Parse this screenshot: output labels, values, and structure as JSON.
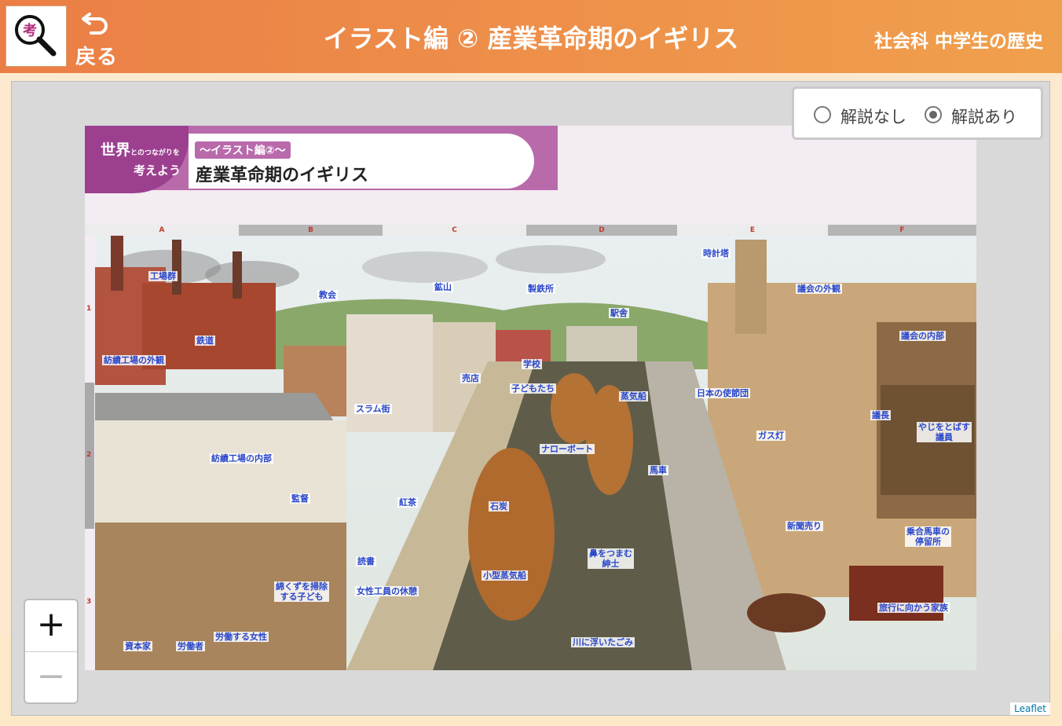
{
  "header": {
    "back_label": "戻る",
    "title": "イラスト編 ② 産業革命期のイギリス",
    "subject": "社会科 中学生の歴史",
    "colors": {
      "from": "#eb7e46",
      "to": "#f0a04d"
    },
    "logo_icon": "magnifier-kou-icon",
    "back_icon": "undo-arrow-icon"
  },
  "controls": {
    "radio_off_label": "解説なし",
    "radio_on_label": "解説あり",
    "selected": "解説あり",
    "zoom_in": "+",
    "zoom_out": "−",
    "attribution": "Leaflet"
  },
  "plate": {
    "badge_line1": "世界",
    "badge_small": "とのつながりを",
    "badge_line2": "考えよう",
    "tag": "〜イラスト編②〜",
    "title": "産業革命期のイギリス",
    "columns": [
      "A",
      "B",
      "C",
      "D",
      "E",
      "F"
    ],
    "rows": [
      "1",
      "2",
      "3"
    ]
  },
  "labels": [
    "工場群",
    "教会",
    "鉱山",
    "製鉄所",
    "時計塔",
    "議会の外観",
    "駅舎",
    "鉄道",
    "紡績工場の外観",
    "学校",
    "子どもたち",
    "売店",
    "スラム街",
    "蒸気船",
    "日本の使節団",
    "議会の内部",
    "議長",
    "やじをとばす\n議員",
    "ガス灯",
    "ナローボート",
    "紡績工場の内部",
    "馬車",
    "監督",
    "紅茶",
    "石炭",
    "新聞売り",
    "乗合馬車の\n停留所",
    "読書",
    "鼻をつまむ\n紳士",
    "小型蒸気船",
    "綿くずを掃除\nする子ども",
    "女性工員の休憩",
    "旅行に向かう家族",
    "資本家",
    "労働者",
    "労働する女性",
    "川に浮いたごみ"
  ]
}
